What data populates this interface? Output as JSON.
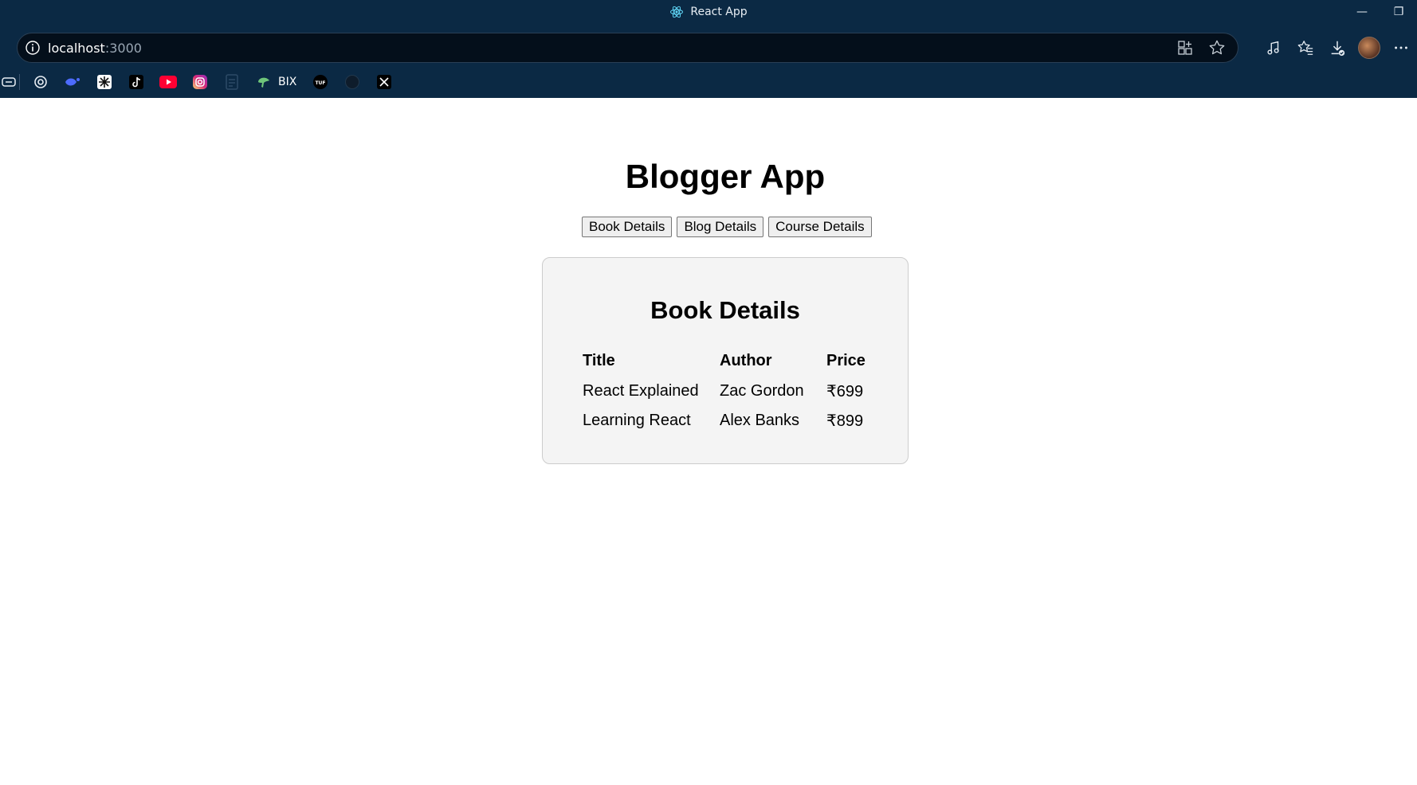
{
  "browser": {
    "tab_title": "React App",
    "url_host": "localhost",
    "url_port": ":3000",
    "minimize_glyph": "—",
    "restore_glyph": "❐",
    "bookmark_label": "BIX",
    "bookmarks": [
      "sidebar-icon",
      "openai-icon",
      "deepseek-icon",
      "grid-app-icon",
      "tiktok-icon",
      "youtube-icon",
      "instagram-icon",
      "sheet-icon",
      "bix-icon",
      "tuf-icon",
      "github-icon",
      "x-icon"
    ]
  },
  "app": {
    "title": "Blogger App",
    "nav": {
      "book": "Book Details",
      "blog": "Blog Details",
      "course": "Course Details"
    }
  },
  "book_details": {
    "heading": "Book Details",
    "columns": {
      "title": "Title",
      "author": "Author",
      "price": "Price"
    },
    "rows": [
      {
        "title": "React Explained",
        "author": "Zac Gordon",
        "price": "₹699"
      },
      {
        "title": "Learning React",
        "author": "Alex Banks",
        "price": "₹899"
      }
    ]
  },
  "colors": {
    "chrome_bg": "#0b2944",
    "address_bg": "#040f1b",
    "card_bg": "#f4f4f4",
    "card_border": "#cccccc"
  }
}
